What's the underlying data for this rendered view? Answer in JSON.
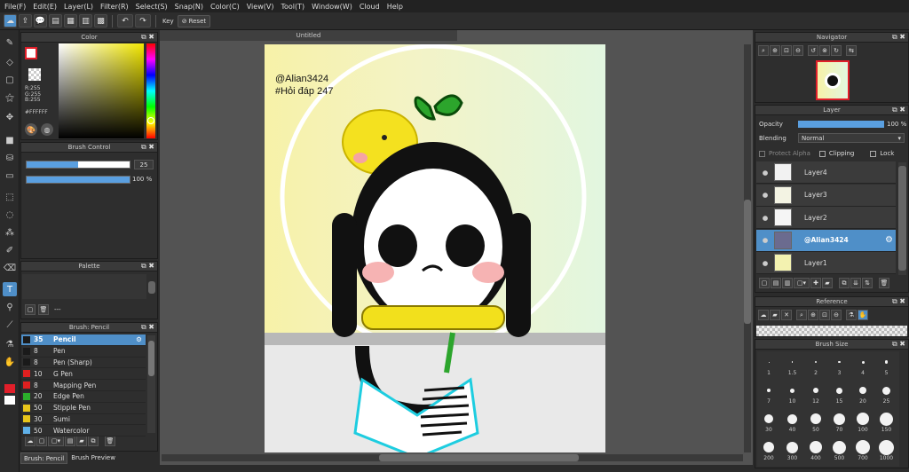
{
  "menu": [
    "File(F)",
    "Edit(E)",
    "Layer(L)",
    "Filter(R)",
    "Select(S)",
    "Snap(N)",
    "Color(C)",
    "View(V)",
    "Tool(T)",
    "Window(W)",
    "Cloud",
    "Help"
  ],
  "toolbar": {
    "key_label": "Key",
    "reset_label": "Reset"
  },
  "color_panel": {
    "title": "Color",
    "r": "R:255",
    "g": "G:255",
    "b": "B:255",
    "hex": "#FFFFFF",
    "fg": "#e11f2a",
    "bg": "#ffffff"
  },
  "brush_control": {
    "title": "Brush Control",
    "size": "25",
    "opacity": "100 %"
  },
  "palette": {
    "title": "Palette",
    "dash": "---"
  },
  "brush_list": {
    "title": "Brush: Pencil",
    "items": [
      {
        "size": "35",
        "name": "Pencil",
        "color": "#1a1a1a"
      },
      {
        "size": "8",
        "name": "Pen",
        "color": "#1a1a1a"
      },
      {
        "size": "8",
        "name": "Pen (Sharp)",
        "color": "#1a1a1a"
      },
      {
        "size": "10",
        "name": "G Pen",
        "color": "#e02020"
      },
      {
        "size": "8",
        "name": "Mapping Pen",
        "color": "#e02020"
      },
      {
        "size": "20",
        "name": "Edge Pen",
        "color": "#2bb02b"
      },
      {
        "size": "50",
        "name": "Stipple Pen",
        "color": "#e8c51a"
      },
      {
        "size": "30",
        "name": "Sumi",
        "color": "#e8c51a"
      },
      {
        "size": "50",
        "name": "Watercolor",
        "color": "#5fb0e8"
      }
    ]
  },
  "bottom_tabs": [
    "Brush: Pencil",
    "Brush Preview"
  ],
  "document": {
    "tab": "Untitled",
    "watermark_1": "@Alian3424",
    "watermark_2": "#Hỏi đáp 247"
  },
  "navigator": {
    "title": "Navigator"
  },
  "layer_panel": {
    "title": "Layer",
    "opacity_label": "Opacity",
    "opacity_value": "100 %",
    "blending_label": "Blending",
    "blending_value": "Normal",
    "protect_alpha": "Protect Alpha",
    "clipping": "Clipping",
    "lock": "Lock",
    "layers": [
      "Layer4",
      "Layer3",
      "Layer2",
      "@Alian3424",
      "Layer1"
    ]
  },
  "reference": {
    "title": "Reference"
  },
  "brush_size": {
    "title": "Brush Size",
    "labels": [
      [
        "1",
        "1.5",
        "2",
        "3",
        "4",
        "5"
      ],
      [
        "7",
        "10",
        "12",
        "15",
        "20",
        "25"
      ],
      [
        "30",
        "40",
        "50",
        "70",
        "100",
        "150"
      ],
      [
        "200",
        "300",
        "400",
        "500",
        "700",
        "1000"
      ]
    ]
  },
  "colors": {
    "accent": "#4f8fc8",
    "bg": "#2b2b2b"
  }
}
